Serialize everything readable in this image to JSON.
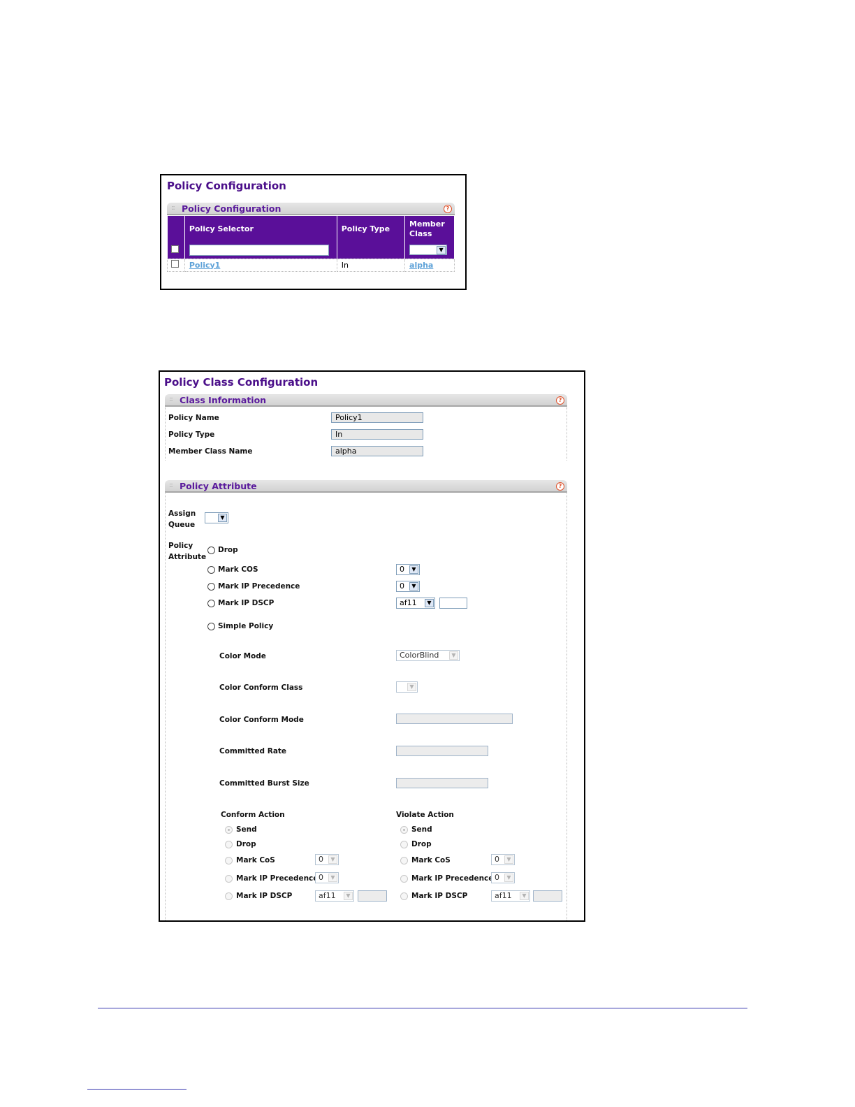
{
  "policy_config": {
    "page_title": "Policy Configuration",
    "section_title": "Policy Configuration",
    "help": "?",
    "columns": [
      "Policy Selector",
      "Policy Type",
      "Member Class"
    ],
    "rows": [
      {
        "selector": "Policy1",
        "type": "In",
        "member_class": "alpha"
      }
    ]
  },
  "policy_class": {
    "page_title": "Policy Class Configuration",
    "class_info": {
      "title": "Class Information",
      "policy_name_label": "Policy Name",
      "policy_name_value": "Policy1",
      "policy_type_label": "Policy Type",
      "policy_type_value": "In",
      "member_class_label": "Member Class Name",
      "member_class_value": "alpha"
    },
    "policy_attr": {
      "title": "Policy Attribute",
      "assign_queue_label_1": "Assign",
      "assign_queue_label_2": "Queue",
      "policy_attr_label_1": "Policy",
      "policy_attr_label_2": "Attribute",
      "drop": "Drop",
      "mark_cos": "Mark COS",
      "mark_cos_value": "0",
      "mark_ip_prec": "Mark IP Precedence",
      "mark_ip_prec_value": "0",
      "mark_ip_dscp": "Mark IP DSCP",
      "mark_ip_dscp_value": "af11",
      "simple_policy": "Simple Policy",
      "color_mode_label": "Color Mode",
      "color_mode_value": "ColorBlind",
      "color_conform_class_label": "Color Conform Class",
      "color_conform_mode_label": "Color Conform Mode",
      "committed_rate_label": "Committed Rate",
      "committed_burst_label": "Committed Burst Size",
      "conform_action": {
        "title": "Conform Action",
        "send": "Send",
        "drop": "Drop",
        "mark_cos": "Mark CoS",
        "mark_cos_value": "0",
        "mark_ip_prec": "Mark IP Precedence",
        "mark_ip_prec_value": "0",
        "mark_ip_dscp": "Mark IP DSCP",
        "mark_ip_dscp_value": "af11"
      },
      "violate_action": {
        "title": "Violate Action",
        "send": "Send",
        "drop": "Drop",
        "mark_cos": "Mark CoS",
        "mark_cos_value": "0",
        "mark_ip_prec": "Mark IP Precedence",
        "mark_ip_prec_value": "0",
        "mark_ip_dscp": "Mark IP DSCP",
        "mark_ip_dscp_value": "af11"
      }
    }
  },
  "icons": {
    "dropdown": "chevron-down-icon",
    "help": "help-icon"
  },
  "colors": {
    "title": "#4b0f8a",
    "table_header": "#5a0f99",
    "link": "#5ea2d8"
  }
}
